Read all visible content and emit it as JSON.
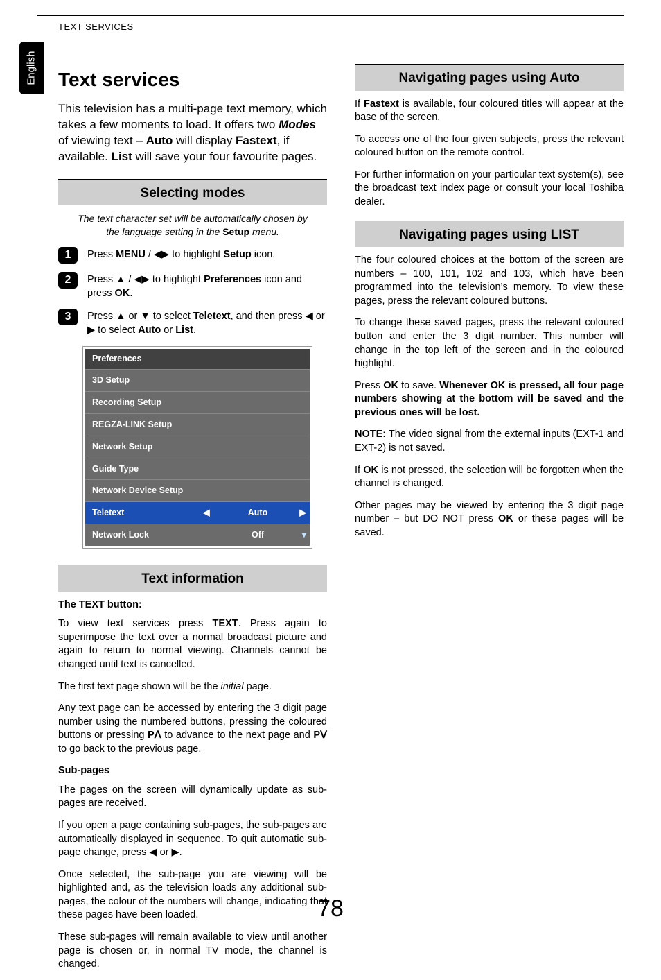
{
  "header": {
    "running_head": "TEXT SERVICES",
    "side_tab": "English"
  },
  "page_number": "78",
  "left": {
    "title": "Text services",
    "intro": {
      "pre": "This television has a multi-page text memory, which takes a few moments to load. It offers two ",
      "modes_word": "Modes",
      "between1": " of viewing text – ",
      "auto": "Auto",
      "between2": " will display ",
      "fastext": "Fastext",
      "between3": ", if available. ",
      "list": "List",
      "after": " will save your four favourite pages."
    },
    "selecting_modes": {
      "heading": "Selecting modes",
      "note_pre": "The text character set will be automatically chosen by the language setting in the ",
      "note_bold": "Setup",
      "note_post": " menu.",
      "step1": {
        "num": "1",
        "a": "Press ",
        "menu": "MENU",
        "b": " / ",
        "c": " to highlight ",
        "setup": "Setup",
        "d": " icon."
      },
      "step2": {
        "num": "2",
        "a": "Press ",
        "b": " / ",
        "c": " to highlight ",
        "prefs": "Preferences",
        "d": " icon and press ",
        "ok": "OK",
        "e": "."
      },
      "step3": {
        "num": "3",
        "a": "Press ",
        "b": " or ",
        "c": " to select ",
        "teletext": "Teletext",
        "d": ", and then press ",
        "e": " or ",
        "f": " to select ",
        "auto": "Auto",
        "g": " or ",
        "list": "List",
        "h": "."
      },
      "menu": {
        "title": "Preferences",
        "rows": [
          "3D Setup",
          "Recording Setup",
          "REGZA-LINK Setup",
          "Network Setup",
          "Guide Type",
          "Network Device Setup"
        ],
        "sel_label": "Teletext",
        "sel_value": "Auto",
        "last_label": "Network Lock",
        "last_value": "Off"
      }
    },
    "text_info": {
      "heading": "Text information",
      "text_button_head": "The TEXT button:",
      "p1a": "To view text services press ",
      "p1_text": "TEXT",
      "p1b": ". Press again to superimpose the text over a normal broadcast picture and again to return to normal viewing. Channels cannot be changed until text is cancelled.",
      "p2a": "The first text page shown will be the ",
      "p2_initial": "initial",
      "p2b": " page.",
      "p3a": "Any text page can be accessed by entering the 3 digit page number using the numbered buttons, pressing the coloured buttons or pressing ",
      "p3_pu": "P",
      "p3b": " to advance to the next page and ",
      "p3_pd": "P",
      "p3c": " to go back to the previous page.",
      "sub_head": "Sub-pages",
      "sp1": "The pages on the screen will dynamically update as sub-pages are received.",
      "sp2a": "If you open a page containing sub-pages, the sub-pages are automatically displayed in sequence. To quit automatic sub-page change, press ",
      "sp2b": " or ",
      "sp2c": ".",
      "sp3": "Once selected, the sub-page you are viewing will be highlighted and, as the television loads any additional sub-pages, the colour of the numbers will change, indicating that these pages have been loaded.",
      "sp4": "These sub-pages will remain available to view until another page is chosen or, in normal TV mode, the channel is changed."
    }
  },
  "right": {
    "nav_auto": {
      "heading": "Navigating pages using Auto",
      "p1a": "If ",
      "p1_fast": "Fastext",
      "p1b": " is available, four coloured titles will appear at the base of the screen.",
      "p2": "To access one of the four given subjects, press the relevant coloured button on the remote control.",
      "p3": "For further information on your particular text system(s), see the broadcast text index page or consult your local Toshiba dealer."
    },
    "nav_list": {
      "heading": "Navigating pages using LIST",
      "p1": "The four coloured choices at the bottom of the screen are numbers – 100, 101, 102 and 103, which have been programmed into the television’s memory. To view these pages, press the relevant coloured buttons.",
      "p2": "To change these saved pages, press the relevant coloured button and enter the 3 digit number. This number will change in the top left of the screen and in the coloured highlight.",
      "p3a": "Press ",
      "p3_ok": "OK",
      "p3b": " to save. ",
      "p3_bold": "Whenever OK is pressed, all four page numbers showing at the bottom will be saved and the previous ones will be lost.",
      "p4a": "NOTE:",
      "p4b": " The video signal from the external inputs (EXT-1 and EXT-2) is not saved.",
      "p5a": "If ",
      "p5_ok": "OK",
      "p5b": " is not pressed, the selection will be forgotten when the channel is changed.",
      "p6a": "Other pages may be viewed by entering the 3 digit page number – but DO NOT press ",
      "p6_ok": "OK",
      "p6b": " or these pages will be saved."
    }
  },
  "glyphs": {
    "left": "◀",
    "right": "▶",
    "up": "▲",
    "down": "▼",
    "pup": "ᐱ",
    "pdown": "ᐯ",
    "scroll_down": "▾"
  }
}
